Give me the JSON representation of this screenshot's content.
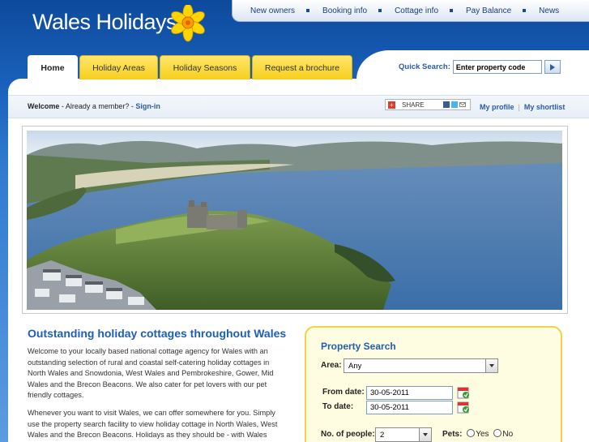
{
  "brand": {
    "name": "Wales Holidays"
  },
  "topnav": {
    "items": [
      "New owners",
      "Booking info",
      "Cottage info",
      "Pay Balance",
      "News"
    ]
  },
  "tabs": [
    "Home",
    "Holiday Areas",
    "Holiday Seasons",
    "Request a brochure"
  ],
  "quick_search": {
    "label": "Quick Search:",
    "value": "Enter property code",
    "button_icon": "arrow-right-icon"
  },
  "welcome": {
    "prefix": "Welcome",
    "text": " - Already a member? - ",
    "signin": "Sign-in"
  },
  "share": {
    "label": "SHARE"
  },
  "account_links": {
    "profile": "My profile",
    "shortlist": "My shortlist"
  },
  "hero": {
    "subject": "castle-coast-photo"
  },
  "content": {
    "headline": "Outstanding holiday cottages throughout Wales",
    "paragraph1": "Welcome to your locally based national cottage agency for Wales with an outstanding selection of rural and coastal self-catering holiday cottages in North Wales and Snowdonia, West Wales and Pembrokeshire, Gower, Mid Wales and the Brecon Beacons. We also cater for pet lovers with our pet friendly cottages.",
    "paragraph2": "Whenever you want to visit Wales, we can offer somewhere for you. Simply use the property search facility to view holiday cottage in North Wales, West Wales and the Brecon Beacons. Holidays as they should be - with Wales"
  },
  "property_search": {
    "title": "Property Search",
    "area_label": "Area:",
    "area_value": "Any",
    "from_label": "From date:",
    "from_value": "30-05-2011",
    "to_label": "To date:",
    "to_value": "30-05-2011",
    "people_label": "No. of people:",
    "people_value": "2",
    "pets_label": "Pets:",
    "pets_yes": "Yes",
    "pets_no": "No"
  },
  "colors": {
    "header_blue": "#0d4a9c",
    "tab_yellow": "#f6cf1d",
    "link_blue": "#2b5aa8",
    "heading_blue": "#1f5fb0",
    "search_bg": "#fffde1"
  }
}
